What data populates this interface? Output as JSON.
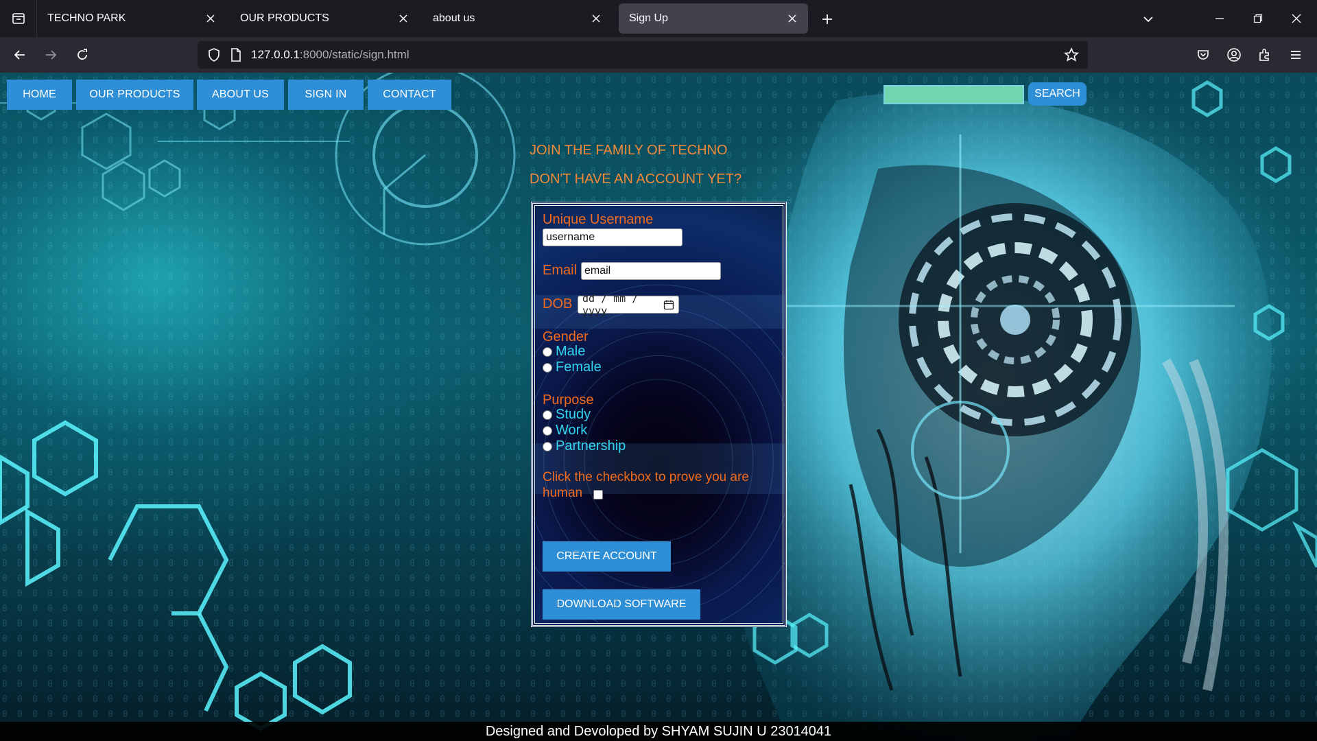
{
  "browser": {
    "tabs": [
      {
        "title": "TECHNO PARK",
        "active": false
      },
      {
        "title": "OUR PRODUCTS",
        "active": false
      },
      {
        "title": "about us",
        "active": false
      },
      {
        "title": "Sign Up",
        "active": true
      }
    ],
    "url": {
      "host": "127.0.0.1",
      "rest": ":8000/static/sign.html"
    }
  },
  "page": {
    "nav": [
      "HOME",
      "OUR PRODUCTS",
      "ABOUT US",
      "SIGN IN",
      "CONTACT"
    ],
    "search": {
      "value": "",
      "button_label": "SEARCH"
    },
    "heading_join": "JOIN THE FAMILY OF TECHNO",
    "heading_account": "DON'T HAVE AN ACCOUNT YET?",
    "form": {
      "username_label": "Unique Username",
      "username_value": "username",
      "email_label": "Email",
      "email_value": "email",
      "dob_label": "DOB",
      "dob_placeholder": "dd / mm / yyyy",
      "gender_label": "Gender",
      "gender_options": [
        "Male",
        "Female"
      ],
      "purpose_label": "Purpose",
      "purpose_options": [
        "Study",
        "Work",
        "Partnership"
      ],
      "human_line1": "Click the checkbox to prove you are",
      "human_line2": "human",
      "create_button": "CREATE ACCOUNT",
      "download_button": "DOWNLOAD SOFTWARE"
    },
    "footer": "Designed and Devoloped by SHYAM SUJIN U 23014041"
  },
  "colors": {
    "nav_blue": "#2f8fd6",
    "label_orange": "#f26b1d",
    "radio_cyan": "#33d6f0",
    "heading_orange": "#f08a3a"
  }
}
